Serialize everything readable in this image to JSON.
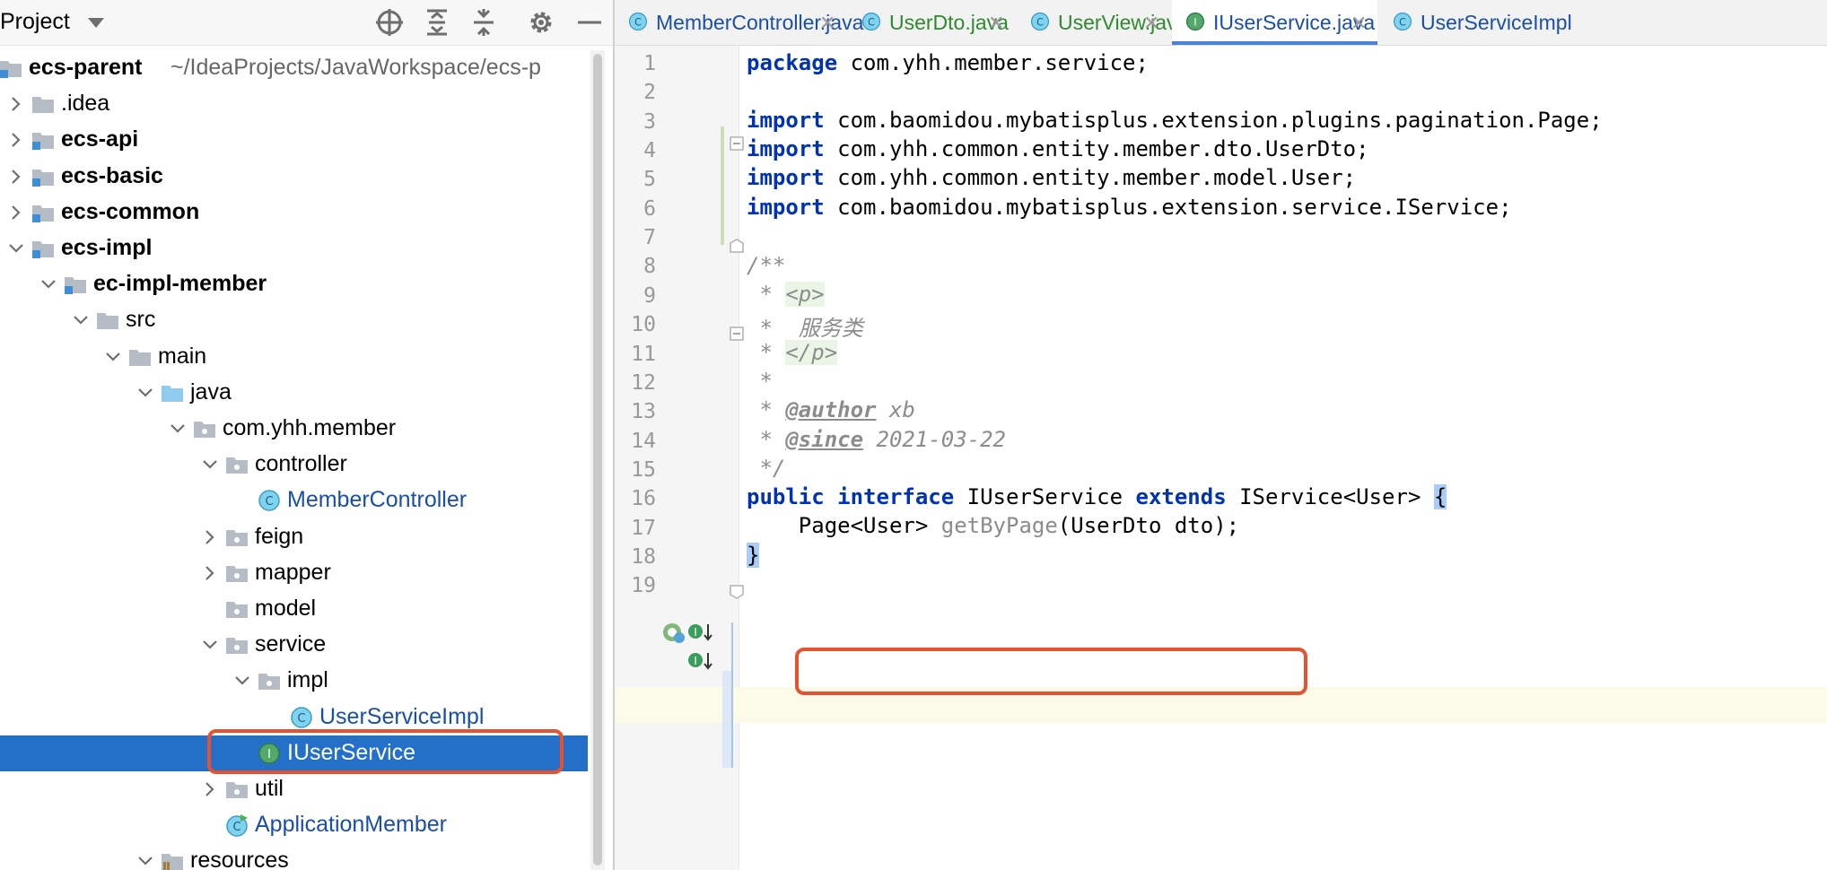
{
  "project_panel": {
    "title": "Project",
    "toolbar_icons": [
      "locate-icon",
      "expand-all-icon",
      "collapse-all-icon",
      "gear-icon",
      "minimize-icon"
    ]
  },
  "tree": [
    {
      "label": "ecs-parent",
      "sub": "~/IdeaProjects/JavaWorkspace/ecs-p",
      "bold": true,
      "icon": "module-folder"
    },
    {
      "label": ".idea",
      "icon": "folder",
      "expand": "collapsed"
    },
    {
      "label": "ecs-api",
      "bold": true,
      "icon": "module-folder",
      "expand": "collapsed"
    },
    {
      "label": "ecs-basic",
      "bold": true,
      "icon": "module-folder",
      "expand": "collapsed"
    },
    {
      "label": "ecs-common",
      "bold": true,
      "icon": "module-folder",
      "expand": "collapsed"
    },
    {
      "label": "ecs-impl",
      "bold": true,
      "icon": "module-folder",
      "expand": "expanded"
    },
    {
      "label": "ec-impl-member",
      "bold": true,
      "icon": "module-folder",
      "expand": "expanded"
    },
    {
      "label": "src",
      "icon": "folder",
      "expand": "expanded"
    },
    {
      "label": "main",
      "icon": "folder",
      "expand": "expanded"
    },
    {
      "label": "java",
      "icon": "source-folder",
      "expand": "expanded"
    },
    {
      "label": "com.yhh.member",
      "icon": "package",
      "expand": "expanded"
    },
    {
      "label": "controller",
      "icon": "package",
      "expand": "expanded"
    },
    {
      "label": "MemberController",
      "icon": "class",
      "blue": true
    },
    {
      "label": "feign",
      "icon": "package",
      "expand": "collapsed"
    },
    {
      "label": "mapper",
      "icon": "package",
      "expand": "collapsed"
    },
    {
      "label": "model",
      "icon": "package"
    },
    {
      "label": "service",
      "icon": "package",
      "expand": "expanded"
    },
    {
      "label": "impl",
      "icon": "package",
      "expand": "expanded"
    },
    {
      "label": "UserServiceImpl",
      "icon": "class",
      "blue": true
    },
    {
      "label": "IUserService",
      "icon": "interface",
      "selected": true
    },
    {
      "label": "util",
      "icon": "package",
      "expand": "collapsed"
    },
    {
      "label": "ApplicationMember",
      "icon": "spring-class",
      "blue": true
    },
    {
      "label": "resources",
      "icon": "resources-folder",
      "expand": "expanded"
    }
  ],
  "tabs": [
    {
      "label": "MemberController.java",
      "icon": "class",
      "color": "#1a4fa8",
      "close": "✕"
    },
    {
      "label": "UserDto.java",
      "icon": "class",
      "color": "#2f8a2f",
      "close": "✕"
    },
    {
      "label": "UserView.java",
      "icon": "class",
      "color": "#2f8a2f",
      "close": "✕"
    },
    {
      "label": "IUserService.java",
      "icon": "interface",
      "color": "#1a4fa8",
      "close": "✕",
      "active": true
    },
    {
      "label": "UserServiceImpl",
      "icon": "class",
      "color": "#1a4fa8"
    }
  ],
  "code": {
    "line_numbers": [
      "1",
      "2",
      "3",
      "4",
      "5",
      "6",
      "7",
      "8",
      "9",
      "10",
      "11",
      "12",
      "13",
      "14",
      "15",
      "16",
      "17",
      "18",
      "19"
    ],
    "l1_kw": "package",
    "l1_rest": " com.yhh.member.service;",
    "l3_kw": "import",
    "l3_rest": " com.baomidou.mybatisplus.extension.plugins.pagination.Page;",
    "l4_kw": "import",
    "l4_rest": " com.yhh.common.entity.member.dto.UserDto;",
    "l5_kw": "import",
    "l5_rest": " com.yhh.common.entity.member.model.User;",
    "l6_kw": "import",
    "l6_rest": " com.baomidou.mybatisplus.extension.service.IService;",
    "l8": "/**",
    "l9_star": " * ",
    "l9_tag": "<p>",
    "l10": " *  服务类",
    "l11_star": " * ",
    "l11_tag": "</p>",
    "l12": " *",
    "l13_star": " * ",
    "l13_tag": "@author",
    "l13_val": " xb",
    "l14_star": " * ",
    "l14_tag": "@since",
    "l14_val": " 2021-03-22",
    "l15": " */",
    "l16_kw1": "public",
    "l16_sp1": " ",
    "l16_kw2": "interface",
    "l16_name": " IUserService ",
    "l16_kw3": "extends",
    "l16_type": " IService<User> ",
    "l16_brace": "{",
    "l17_indent": "    ",
    "l17_type": "Page<User> ",
    "l17_method": "getByPage",
    "l17_params": "(UserDto dto);",
    "l18_brace": "}"
  }
}
